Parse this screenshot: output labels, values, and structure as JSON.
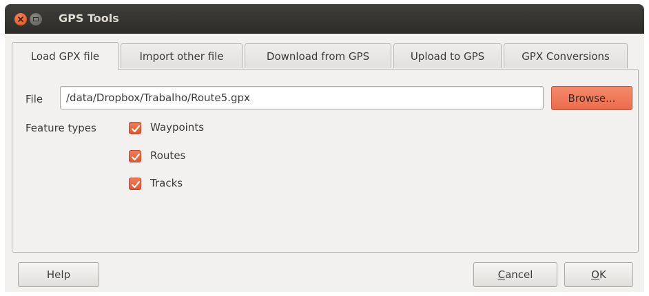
{
  "window": {
    "title": "GPS Tools"
  },
  "tabs": [
    {
      "label": "Load GPX file"
    },
    {
      "label": "Import other file"
    },
    {
      "label": "Download from GPS"
    },
    {
      "label": "Upload to GPS"
    },
    {
      "label": "GPX Conversions"
    }
  ],
  "active_tab": "Load GPX file",
  "load": {
    "file_label": "File",
    "file_value": "/data/Dropbox/Trabalho/Route5.gpx",
    "browse_label": "Browse...",
    "feature_types_label": "Feature types",
    "checkboxes": [
      {
        "label": "Waypoints",
        "checked": true
      },
      {
        "label": "Routes",
        "checked": true
      },
      {
        "label": "Tracks",
        "checked": true
      }
    ]
  },
  "buttons": {
    "help": "Help",
    "cancel_mnemonic": "C",
    "cancel_rest": "ancel",
    "ok_mnemonic": "O",
    "ok_rest": "K"
  },
  "colors": {
    "accent": "#ec6c4a",
    "titlebar": "#3a3935",
    "window_bg": "#f2f1f0"
  },
  "icons": {
    "close": "close-icon",
    "minimize": "minimize-icon",
    "check": "checkmark-icon"
  }
}
